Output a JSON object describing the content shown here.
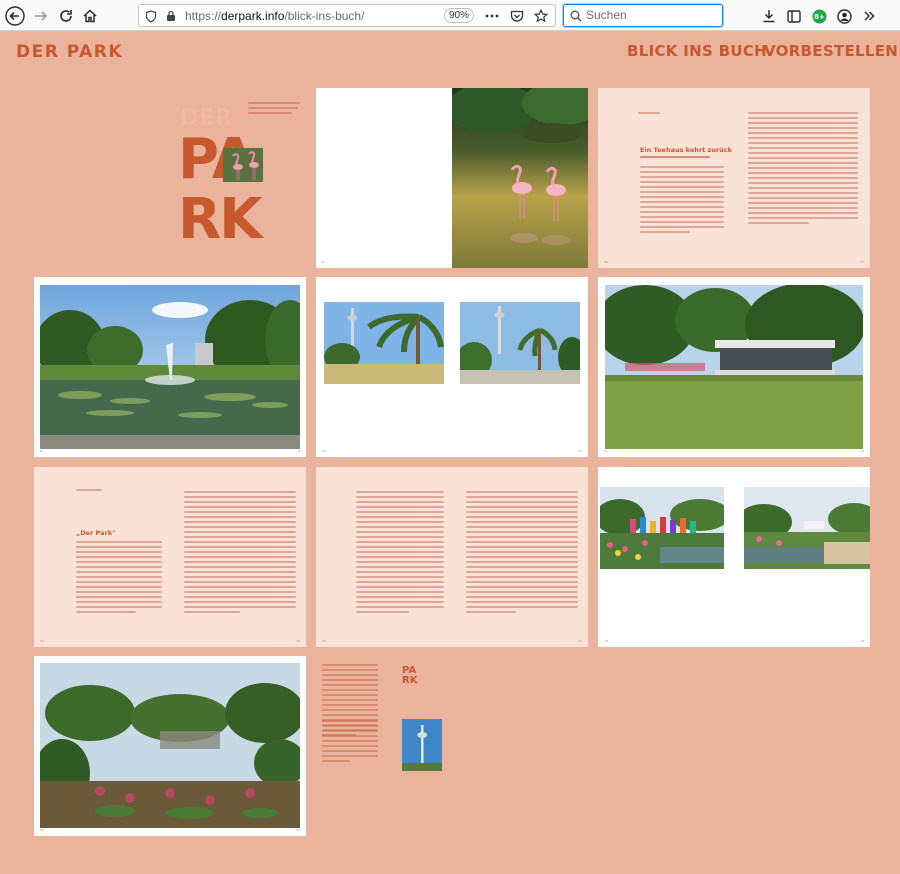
{
  "browser": {
    "url_prefix": "https://",
    "url_domain": "derpark.info",
    "url_path": "/blick-ins-buch/",
    "zoom": "90%",
    "search_placeholder": "Suchen",
    "extension_badge": "8+"
  },
  "site": {
    "logo": "DER PARK",
    "nav": [
      "BLICK INS BUCH",
      "VORBESTELLEN"
    ]
  },
  "spreads": {
    "cover": {
      "der": "DER",
      "pa": "PA",
      "rk": "RK"
    },
    "text_heading_1": "Ein Teehaus kehrt zurück",
    "text_heading_2": "„Der Park\"",
    "back_logo_1": "PA",
    "back_logo_2": "RK"
  },
  "colors": {
    "background": "#eab39c",
    "accent": "#c8582e",
    "page_tint": "#fae2d7"
  }
}
